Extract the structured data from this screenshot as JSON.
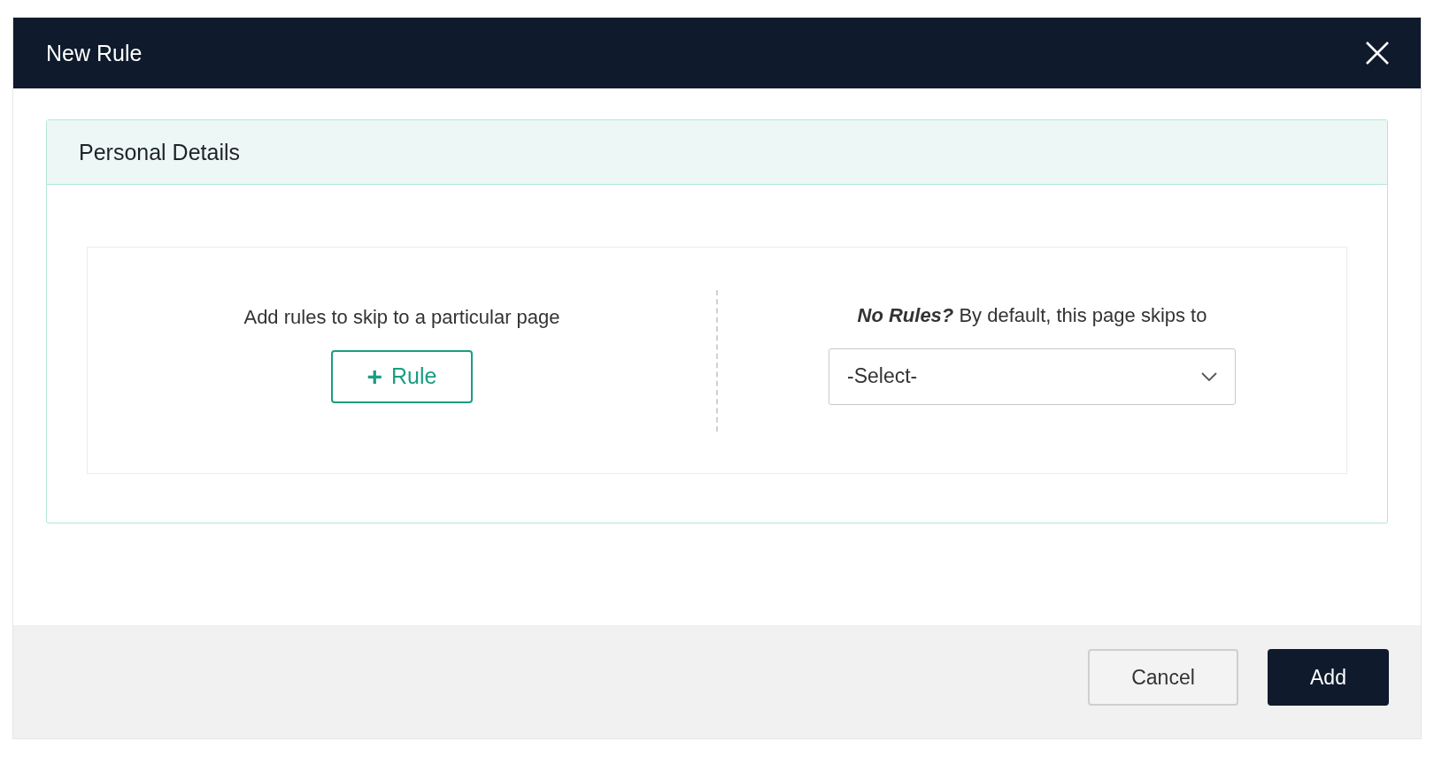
{
  "dialog": {
    "title": "New Rule"
  },
  "section": {
    "title": "Personal Details",
    "rules_prompt": "Add rules to skip to a particular page",
    "add_rule_button": {
      "icon": "+",
      "label": "Rule"
    },
    "default_note": {
      "lead": "No Rules?",
      "text": "By default, this page skips to"
    },
    "default_select": {
      "value": "-Select-"
    }
  },
  "buttons": [
    {
      "label": "Cancel",
      "kind": "secondary"
    },
    {
      "label": "Add",
      "kind": "primary"
    }
  ]
}
